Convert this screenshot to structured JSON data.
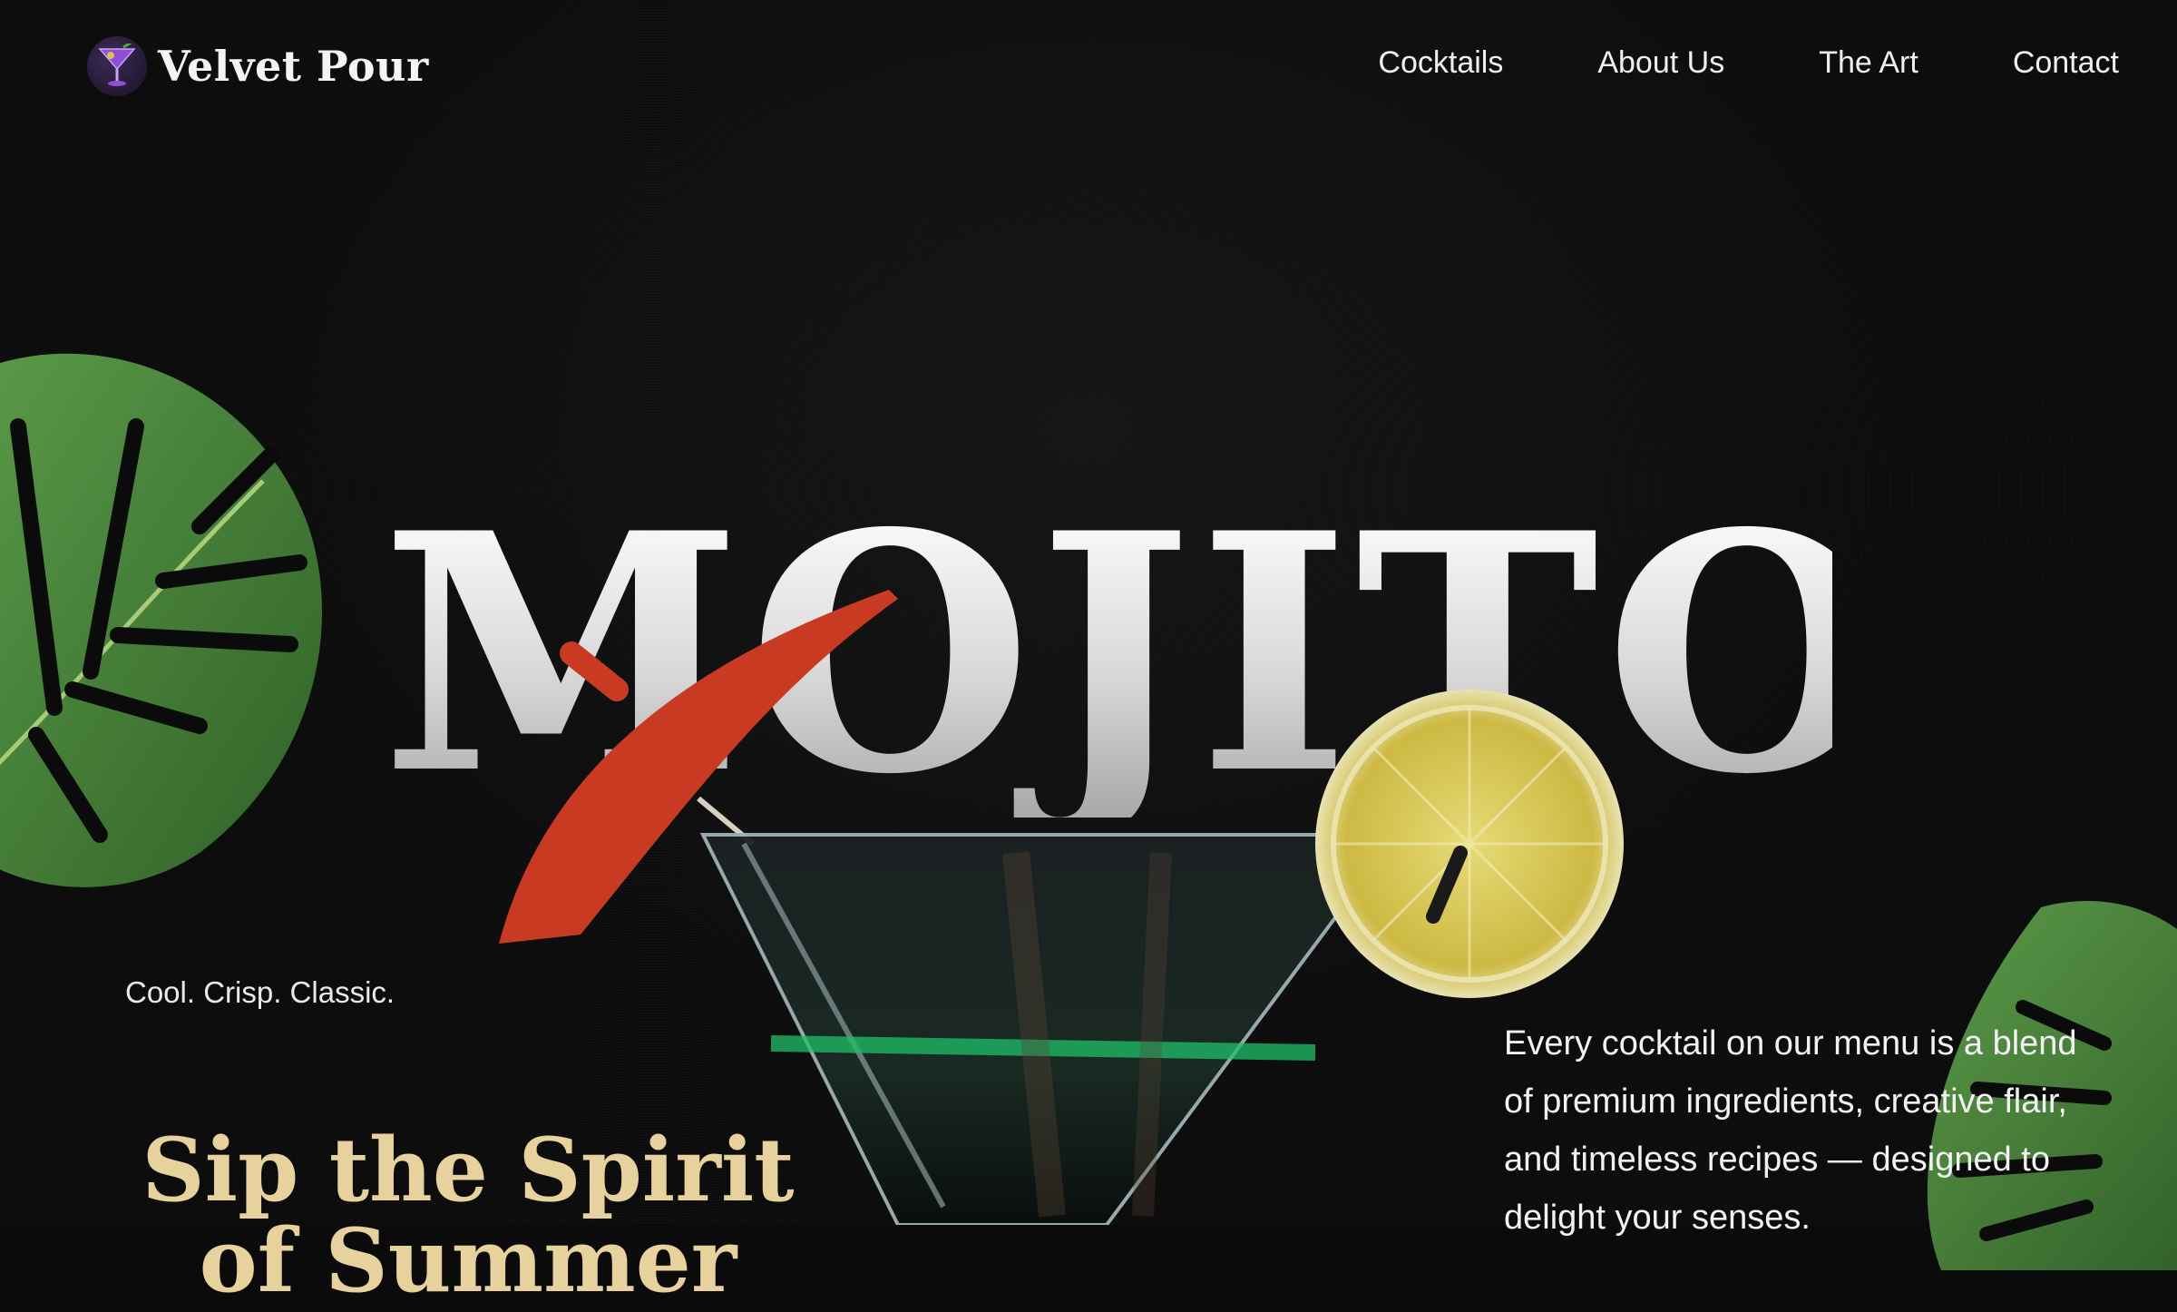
{
  "brand": {
    "name": "Velvet Pour",
    "logo_icon": "cocktail-glass-icon",
    "accent": "#7b4cc1"
  },
  "nav": {
    "items": [
      {
        "label": "Cocktails"
      },
      {
        "label": "About Us"
      },
      {
        "label": "The Art"
      },
      {
        "label": "Contact"
      }
    ]
  },
  "hero": {
    "title": "MOJITO",
    "tagline": "Cool. Crisp. Classic.",
    "headline_line1": "Sip the Spirit",
    "headline_line2": "of Summer",
    "headline_color": "#e7d29d",
    "blurb": "Every cocktail on our menu is a blend of premium ingredients, creative flair, and timeless recipes — designed to delight your senses."
  },
  "colors": {
    "background": "#0b0b0b",
    "leaf_green": "#3d7a34",
    "umbrella_red": "#d23a22",
    "lime_yellow": "#d9c64a"
  }
}
